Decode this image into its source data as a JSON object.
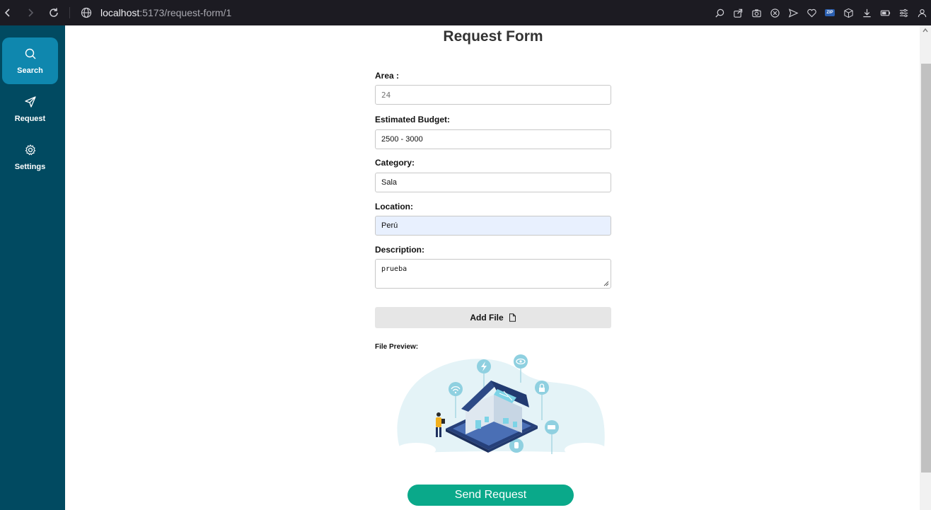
{
  "browser": {
    "url_host": "localhost",
    "url_path": ":5173/request-form/1",
    "zip_badge": "ZIP"
  },
  "sidebar": {
    "items": [
      {
        "label": "Search",
        "icon": "search-icon",
        "active": true
      },
      {
        "label": "Request",
        "icon": "send-icon",
        "active": false
      },
      {
        "label": "Settings",
        "icon": "gear-icon",
        "active": false
      }
    ]
  },
  "form": {
    "title": "Request Form",
    "area": {
      "label": "Area :",
      "placeholder": "24"
    },
    "budget": {
      "label": "Estimated Budget:",
      "value": "2500 - 3000"
    },
    "category": {
      "label": "Category:",
      "value": "Sala"
    },
    "location": {
      "label": "Location:",
      "value": "Perú"
    },
    "description": {
      "label": "Description:",
      "value": "prueba"
    },
    "add_file_label": "Add File",
    "preview_label": "File Preview:",
    "send_label": "Send Request"
  },
  "colors": {
    "sidebar_bg": "#014a61",
    "sidebar_active": "#0f87ae",
    "send_button": "#0aa98a",
    "autofill_bg": "#e8f0fe"
  }
}
